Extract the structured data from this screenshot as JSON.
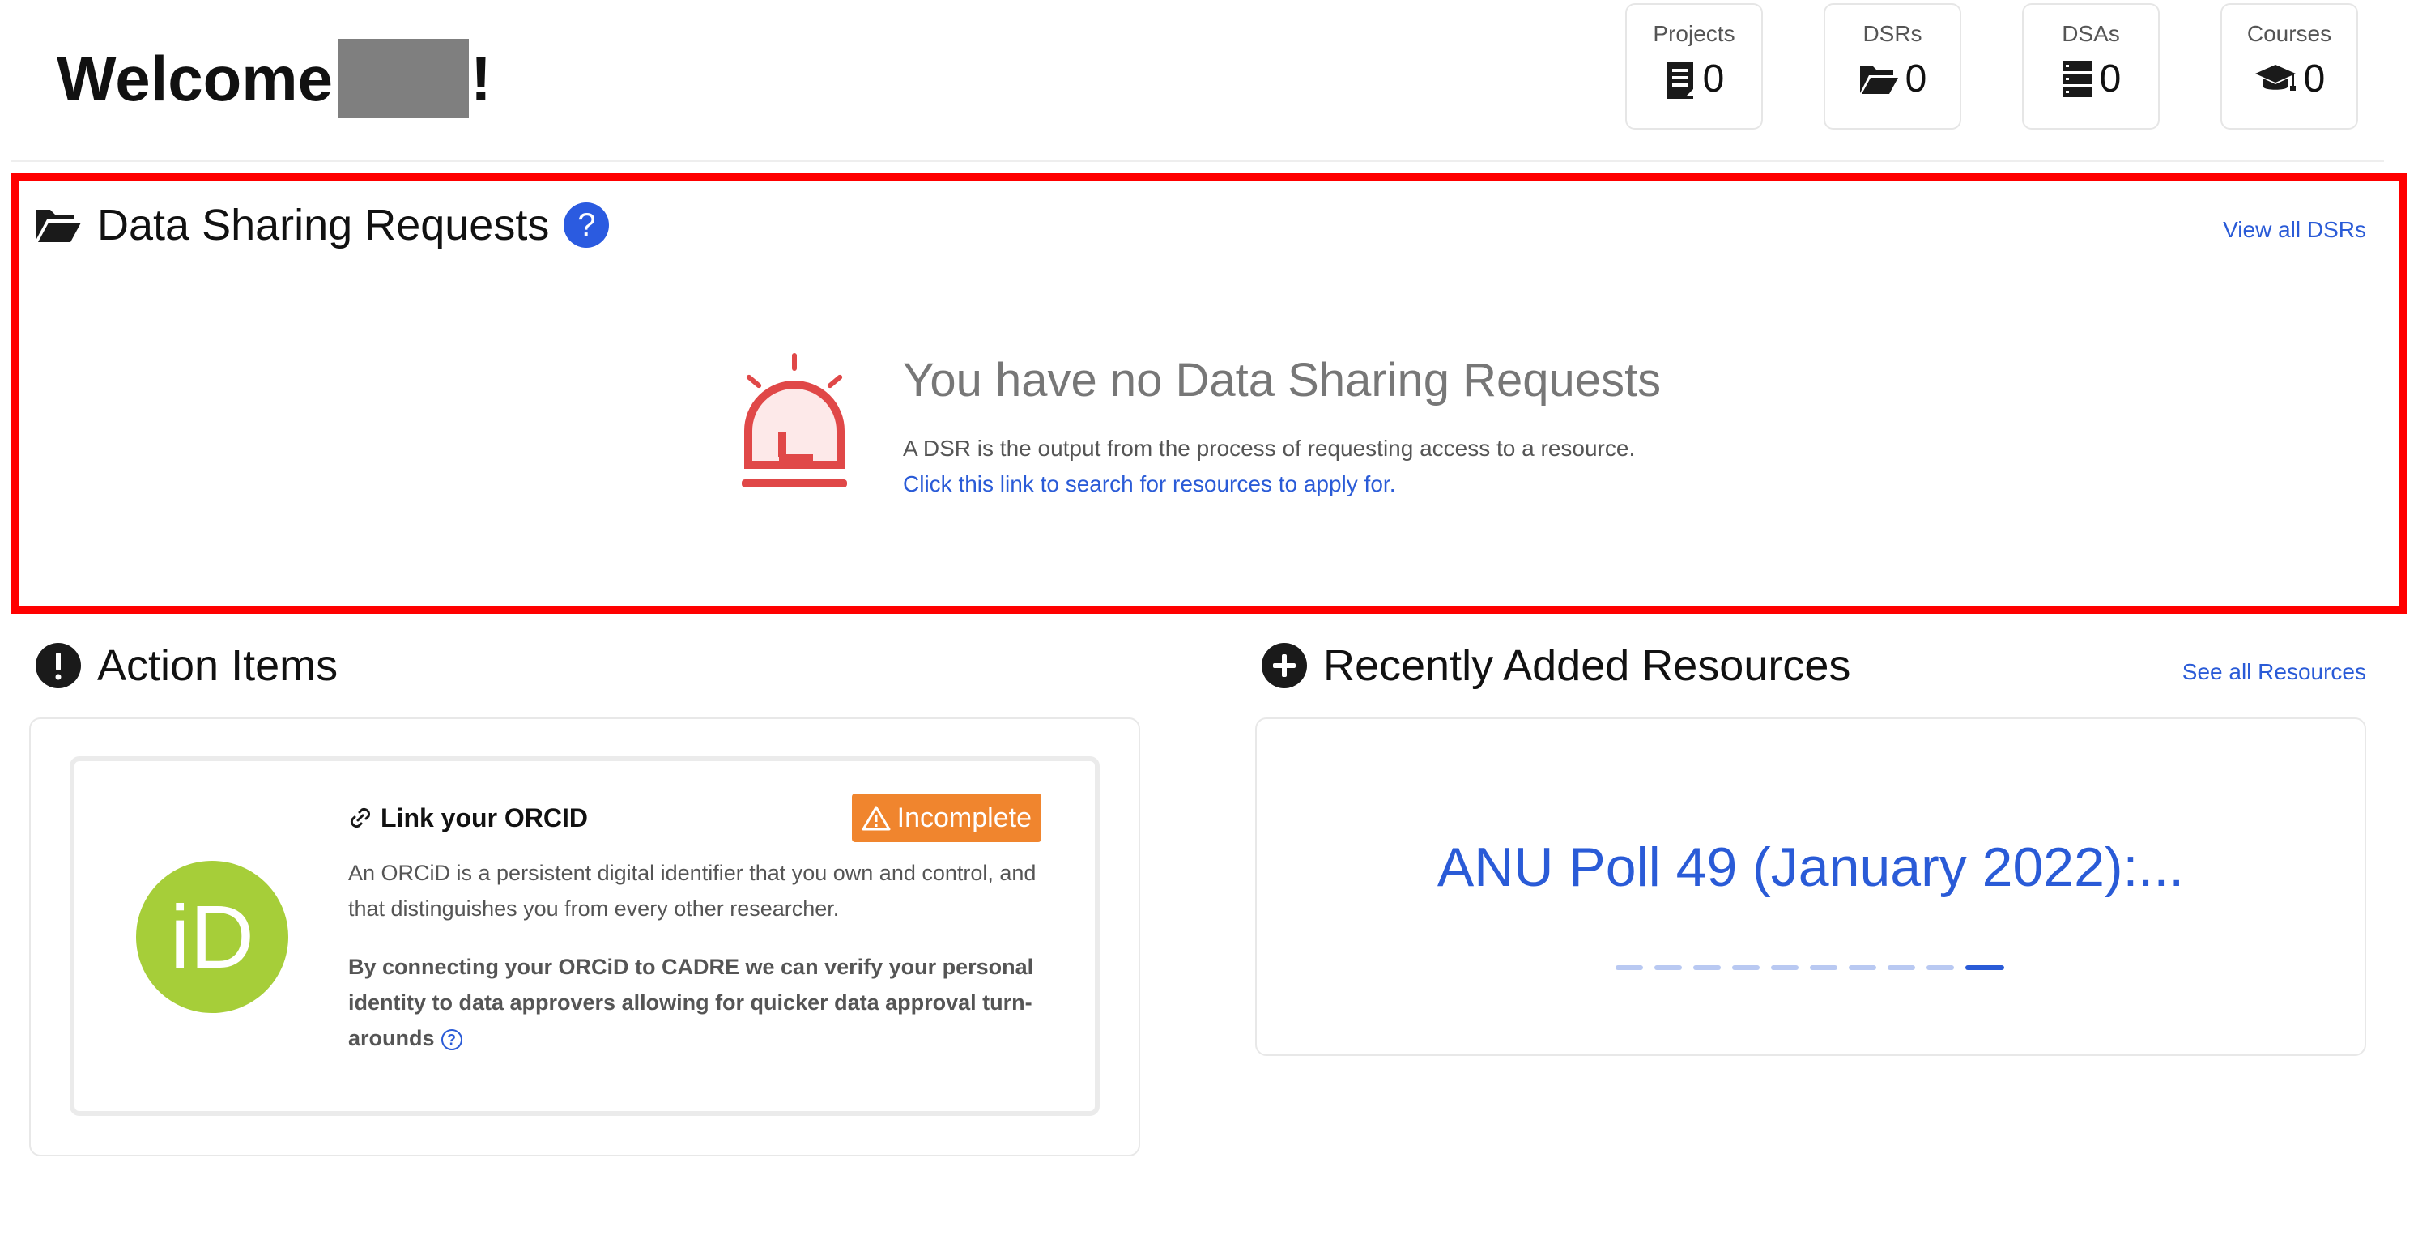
{
  "header": {
    "welcome_text": "Welcome",
    "welcome_suffix": "!",
    "stats": [
      {
        "label": "Projects",
        "value": "0",
        "icon": "clipboard-list-icon"
      },
      {
        "label": "DSRs",
        "value": "0",
        "icon": "folder-open-icon"
      },
      {
        "label": "DSAs",
        "value": "0",
        "icon": "server-icon"
      },
      {
        "label": "Courses",
        "value": "0",
        "icon": "graduation-cap-icon"
      }
    ]
  },
  "dsr": {
    "title": "Data Sharing Requests",
    "help_label": "?",
    "view_all": "View all DSRs",
    "empty_title": "You have no Data Sharing Requests",
    "empty_text": "A DSR is the output from the process of requesting access to a resource.",
    "empty_link": "Click this link to search for resources to apply for."
  },
  "action_items": {
    "title": "Action Items",
    "orcid": {
      "logo_text": "iD",
      "title": "Link your ORCID",
      "status": "Incomplete",
      "description": "An ORCiD is a persistent digital identifier that you own and control, and that distinguishes you from every other researcher.",
      "benefit": "By connecting your ORCiD to CADRE we can verify your personal identity to data approvers allowing for quicker data approval turn-arounds",
      "help_label": "?"
    }
  },
  "resources": {
    "title": "Recently Added Resources",
    "see_all": "See all Resources",
    "items": [
      {
        "title": "ANU Poll 49 (January 2022):..."
      }
    ],
    "carousel": {
      "count": 10,
      "active_index": 9
    }
  },
  "colors": {
    "accent": "#2a5bd7",
    "highlight_border": "#ff0000",
    "badge": "#f0852e",
    "orcid_green": "#a6ce39",
    "alert_red": "#e04848"
  }
}
